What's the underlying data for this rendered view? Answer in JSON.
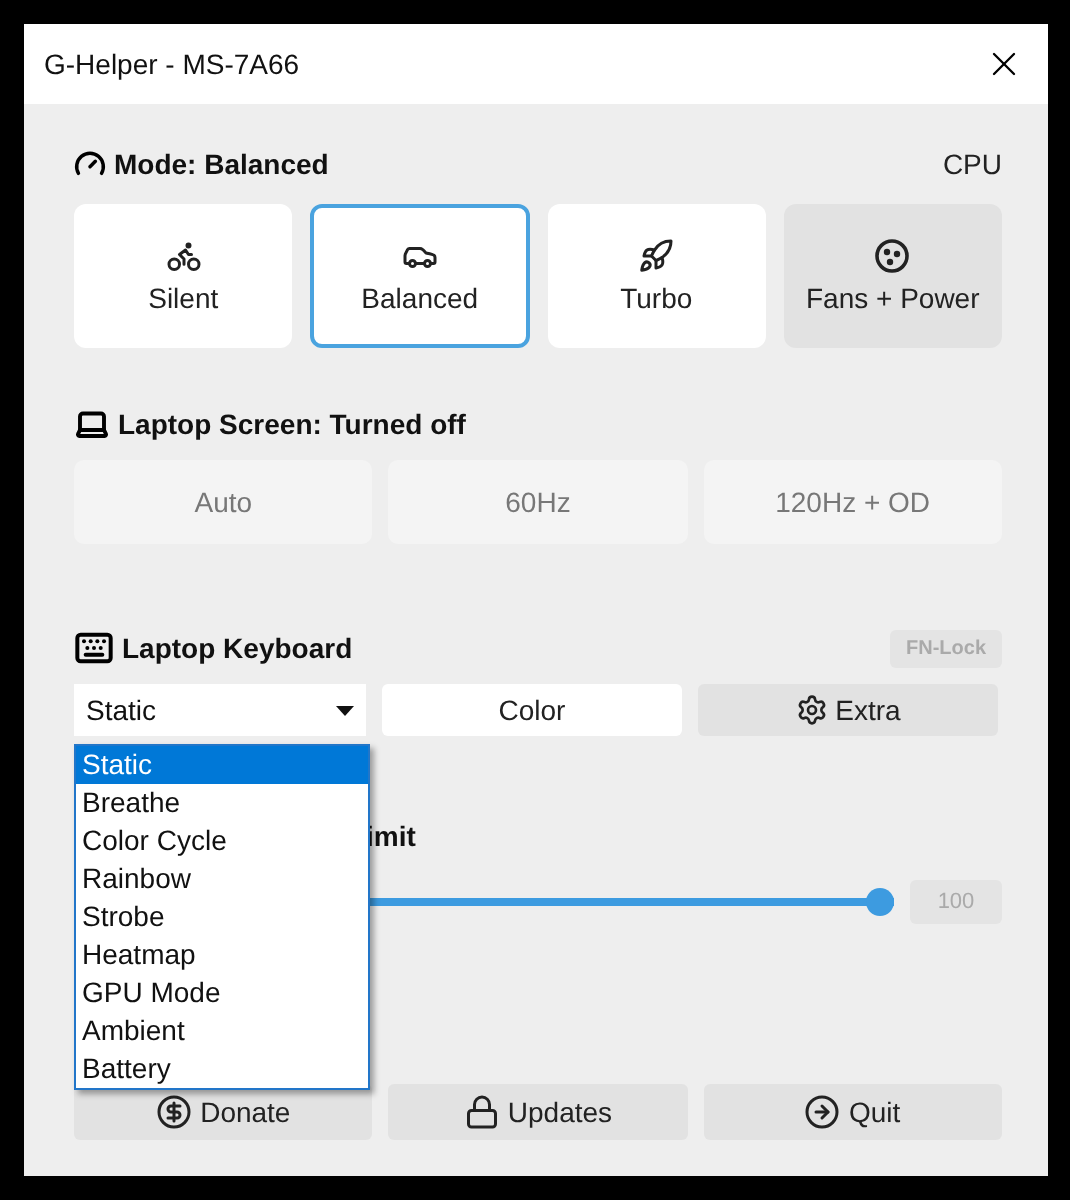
{
  "window": {
    "title": "G-Helper - MS-7A66"
  },
  "mode": {
    "title": "Mode: Balanced",
    "side_label": "CPU",
    "buttons": [
      {
        "label": "Silent",
        "kind": "mode",
        "selected": false
      },
      {
        "label": "Balanced",
        "kind": "mode",
        "selected": true
      },
      {
        "label": "Turbo",
        "kind": "mode",
        "selected": false
      },
      {
        "label": "Fans + Power",
        "kind": "settings",
        "selected": false
      }
    ]
  },
  "screen": {
    "title": "Laptop Screen: Turned off",
    "buttons": [
      {
        "label": "Auto",
        "disabled": true
      },
      {
        "label": "60Hz",
        "disabled": true
      },
      {
        "label": "120Hz + OD",
        "disabled": true
      }
    ]
  },
  "keyboard": {
    "title": "Laptop Keyboard",
    "fn_lock": {
      "label": "FN-Lock",
      "disabled": true
    },
    "mode_select": {
      "value": "Static",
      "expanded": true,
      "options": [
        {
          "label": "Static",
          "selected": true
        },
        {
          "label": "Breathe",
          "selected": false
        },
        {
          "label": "Color Cycle",
          "selected": false
        },
        {
          "label": "Rainbow",
          "selected": false
        },
        {
          "label": "Strobe",
          "selected": false
        },
        {
          "label": "Heatmap",
          "selected": false
        },
        {
          "label": "GPU Mode",
          "selected": false
        },
        {
          "label": "Ambient",
          "selected": false
        },
        {
          "label": "Battery",
          "selected": false
        }
      ]
    },
    "color_button": "Color",
    "extra_button": "Extra"
  },
  "battery": {
    "title": "imit",
    "level": 1,
    "reading": "100"
  },
  "footer": {
    "buttons": [
      "Donate",
      "Updates",
      "Quit"
    ]
  }
}
